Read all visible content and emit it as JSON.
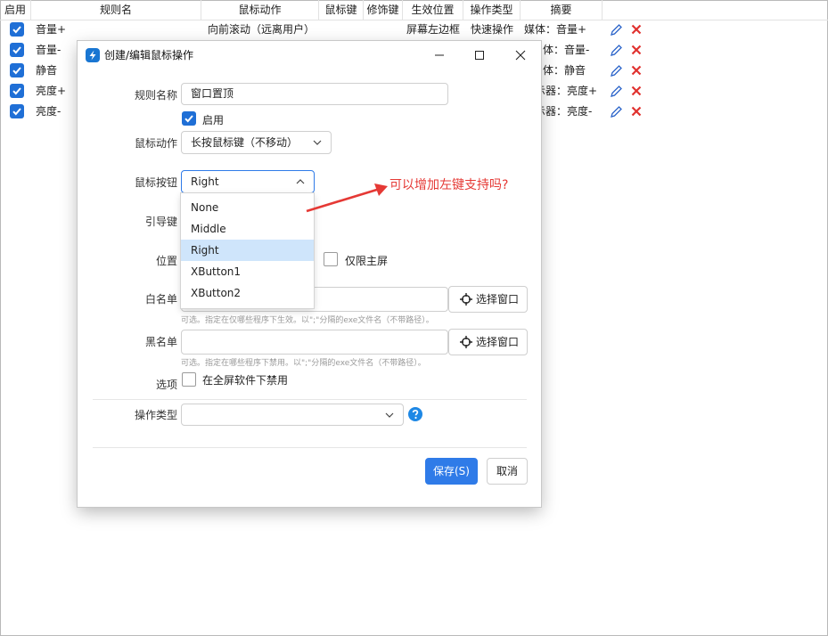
{
  "table": {
    "headers": [
      "启用",
      "规则名",
      "鼠标动作",
      "鼠标键",
      "修饰键",
      "生效位置",
      "操作类型",
      "摘要"
    ],
    "rows": [
      {
        "name": "音量+",
        "action": "向前滚动（远离用户）",
        "position": "屏幕左边框",
        "op_type": "快速操作",
        "summary": "媒体：音量+"
      },
      {
        "name": "音量-",
        "action": "",
        "position": "",
        "op_type": "",
        "summary": "体：音量-"
      },
      {
        "name": "静音",
        "action": "",
        "position": "",
        "op_type": "",
        "summary": "体：静音"
      },
      {
        "name": "亮度+",
        "action": "",
        "position": "",
        "op_type": "",
        "summary": "示器：亮度+"
      },
      {
        "name": "亮度-",
        "action": "",
        "position": "",
        "op_type": "",
        "summary": "示器：亮度-"
      }
    ],
    "colors": {
      "check": "#1f6fd6",
      "edit": "#2a63c9",
      "delete": "#e0322f"
    }
  },
  "dialog": {
    "title": "创建/编辑鼠标操作",
    "labels": {
      "rule_name": "规则名称",
      "enabled": "启用",
      "mouse_action": "鼠标动作",
      "mouse_button": "鼠标按钮",
      "leader_key": "引导键",
      "position": "位置",
      "main_screen_only": "仅限主屏",
      "whitelist": "白名单",
      "blacklist": "黑名单",
      "options": "选项",
      "disable_fullscreen": "在全屏软件下禁用",
      "op_type": "操作类型"
    },
    "values": {
      "rule_name": "窗口置顶",
      "mouse_action": "长按鼠标键（不移动）",
      "mouse_button": "Right",
      "op_type": ""
    },
    "buttons": {
      "select_window": "选择窗口",
      "save": "保存(S)",
      "cancel": "取消"
    },
    "hints": {
      "whitelist": "可选。指定在仅哪些程序下生效。以\";\"分隔的exe文件名（不带路径）。",
      "blacklist": "可选。指定在哪些程序下禁用。以\";\"分隔的exe文件名（不带路径）。"
    },
    "dropdown_options": [
      "None",
      "Middle",
      "Right",
      "XButton1",
      "XButton2"
    ],
    "selected_option": "Right",
    "colors": {
      "accent": "#2f7be8",
      "selected_bg": "#cfe5fb",
      "help": "#1e88e5"
    }
  },
  "annotation": {
    "text": "可以增加左键支持吗?",
    "color": "#e53935"
  }
}
